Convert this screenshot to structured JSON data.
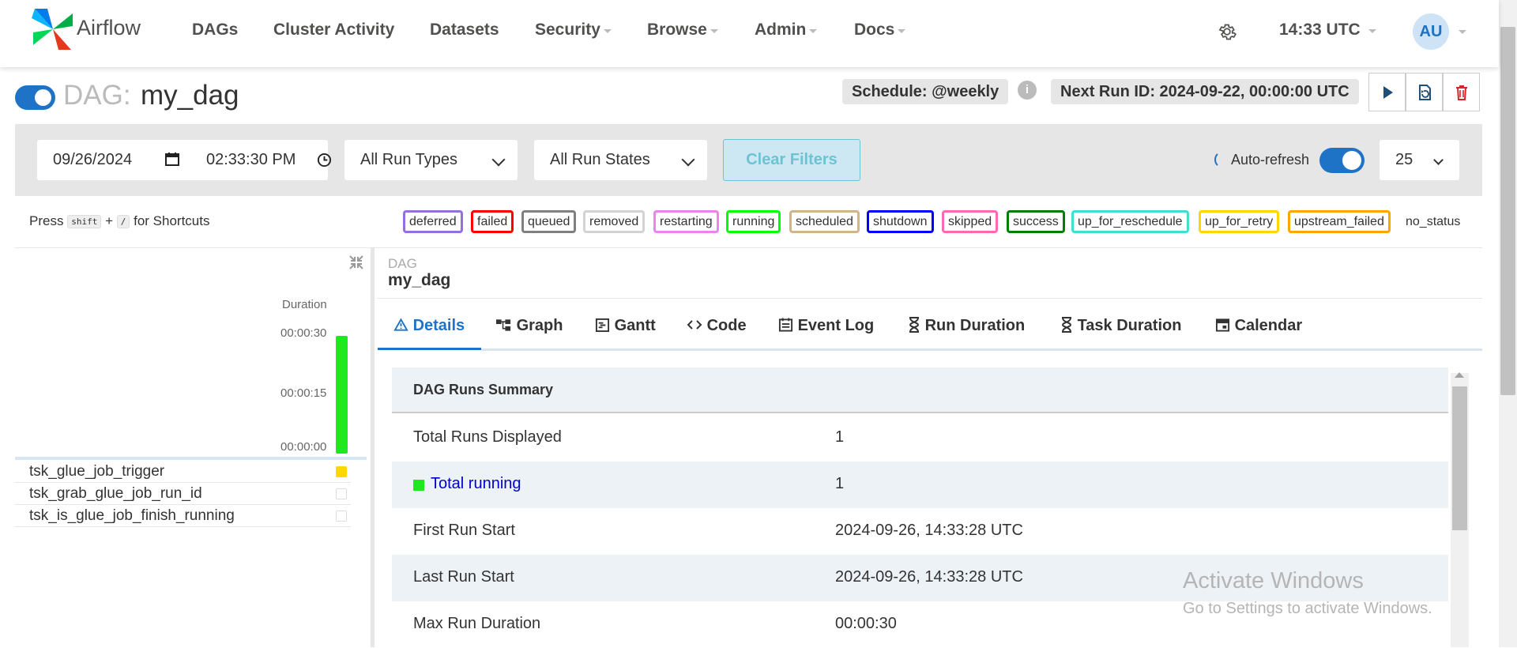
{
  "nav": {
    "brand": "Airflow",
    "items": [
      "DAGs",
      "Cluster Activity",
      "Datasets",
      "Security",
      "Browse",
      "Admin",
      "Docs"
    ],
    "clock": "14:33 UTC",
    "avatar": "AU"
  },
  "dag": {
    "prefix": "DAG:",
    "name": "my_dag",
    "schedule": "Schedule: @weekly",
    "next_run": "Next Run ID: 2024-09-22, 00:00:00 UTC",
    "toggle_on": true
  },
  "filters": {
    "date": "09/26/2024",
    "time": "02:33:30  PM",
    "run_types": "All Run Types",
    "run_states": "All Run States",
    "clear": "Clear Filters",
    "auto_refresh": "Auto-refresh",
    "page_size": "25"
  },
  "shortcuts": {
    "press": "Press",
    "key1": "shift",
    "plus": "+",
    "key2": "/",
    "suffix": "for Shortcuts"
  },
  "legend": [
    {
      "label": "deferred",
      "color": "#9370db"
    },
    {
      "label": "failed",
      "color": "#ff0000"
    },
    {
      "label": "queued",
      "color": "#808080"
    },
    {
      "label": "removed",
      "color": "#d3d3d3"
    },
    {
      "label": "restarting",
      "color": "#ee82ee"
    },
    {
      "label": "running",
      "color": "#01ff01"
    },
    {
      "label": "scheduled",
      "color": "#d2b48c"
    },
    {
      "label": "shutdown",
      "color": "#0000ff"
    },
    {
      "label": "skipped",
      "color": "#ff69b4"
    },
    {
      "label": "success",
      "color": "#008000"
    },
    {
      "label": "up_for_reschedule",
      "color": "#40e0d0"
    },
    {
      "label": "up_for_retry",
      "color": "#ffd700"
    },
    {
      "label": "upstream_failed",
      "color": "#ffa500"
    },
    {
      "label": "no_status",
      "color": "#ffffff"
    }
  ],
  "grid": {
    "duration_label": "Duration",
    "ticks": [
      "00:00:30",
      "00:00:15",
      "00:00:00"
    ],
    "run_duration": "00:00:30",
    "tasks": [
      {
        "name": "tsk_glue_job_trigger",
        "status_color": "#ffd700"
      },
      {
        "name": "tsk_grab_glue_job_run_id",
        "status_color": "#ffffff"
      },
      {
        "name": "tsk_is_glue_job_finish_running",
        "status_color": "#ffffff"
      }
    ]
  },
  "panel": {
    "small": "DAG",
    "title": "my_dag",
    "tabs": [
      "Details",
      "Graph",
      "Gantt",
      "Code",
      "Event Log",
      "Run Duration",
      "Task Duration",
      "Calendar"
    ],
    "summary_title": "DAG Runs Summary",
    "rows": [
      {
        "key": "Total Runs Displayed",
        "value": "1"
      },
      {
        "key": "Total running",
        "value": "1"
      },
      {
        "key": "First Run Start",
        "value": "2024-09-26, 14:33:28 UTC"
      },
      {
        "key": "Last Run Start",
        "value": "2024-09-26, 14:33:28 UTC"
      },
      {
        "key": "Max Run Duration",
        "value": "00:00:30"
      }
    ]
  },
  "watermark": {
    "line1": "Activate Windows",
    "line2": "Go to Settings to activate Windows."
  },
  "colors": {
    "accent": "#1f73c7",
    "running": "#1ee81e"
  }
}
